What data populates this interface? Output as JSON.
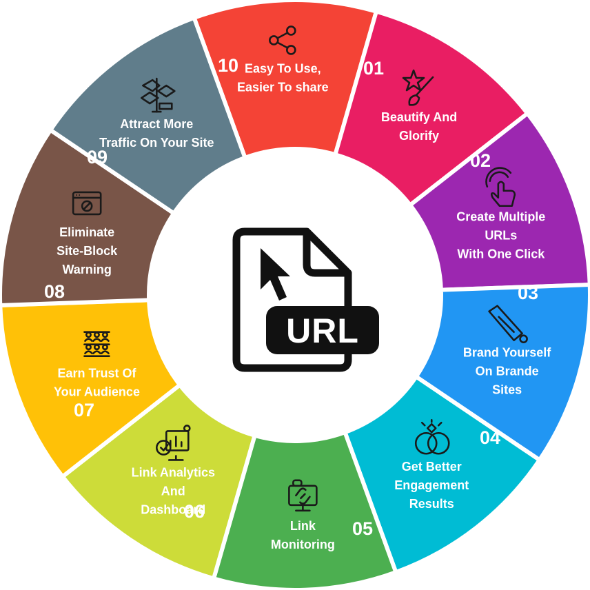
{
  "center": {
    "label": "URL",
    "icon": "url-file-icon"
  },
  "segments": [
    {
      "number": "01",
      "lines": [
        "Easy To Use,",
        "Easier To share"
      ],
      "color": "#f44336",
      "icon": "share-icon"
    },
    {
      "number": "02",
      "lines": [
        "Beautify And",
        "Glorify"
      ],
      "color": "#e91e63",
      "icon": "star-wand-icon"
    },
    {
      "number": "03",
      "lines": [
        "Create Multiple",
        "URLs",
        "With One Click"
      ],
      "color": "#9c27b0",
      "icon": "tap-hand-icon"
    },
    {
      "number": "04",
      "lines": [
        "Brand Yourself",
        "On Brande",
        "Sites"
      ],
      "color": "#2196f3",
      "icon": "brand-tag-icon"
    },
    {
      "number": "05",
      "lines": [
        "Get Better",
        "Engagement",
        "Results"
      ],
      "color": "#00bcd4",
      "icon": "rings-icon"
    },
    {
      "number": "06",
      "lines": [
        "Link",
        "Monitoring"
      ],
      "color": "#4caf50",
      "icon": "monitor-link-icon"
    },
    {
      "number": "07",
      "lines": [
        "Link Analytics",
        "And",
        "Dashboard"
      ],
      "color": "#cddc39",
      "icon": "analytics-dashboard-icon"
    },
    {
      "number": "08",
      "lines": [
        "Earn Trust Of",
        "Your Audience"
      ],
      "color": "#ffc107",
      "icon": "audience-icon"
    },
    {
      "number": "09",
      "lines": [
        "Eliminate",
        "Site-Block",
        "Warning"
      ],
      "color": "#795548",
      "icon": "blocked-site-icon"
    },
    {
      "number": "10",
      "lines": [
        "Attract More",
        "Traffic On Your Site"
      ],
      "color": "#607d8b",
      "icon": "traffic-signs-icon"
    }
  ]
}
